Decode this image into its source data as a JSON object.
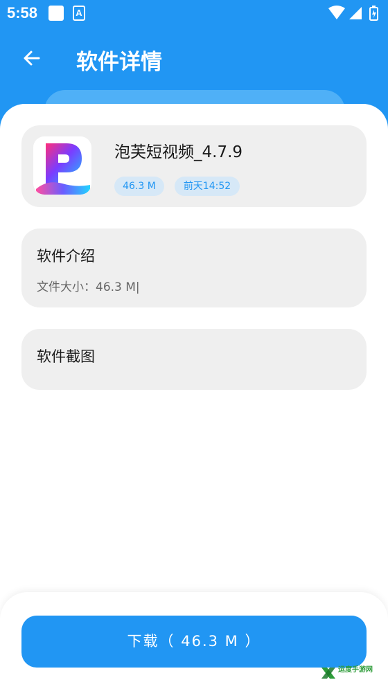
{
  "status_bar": {
    "time": "5:58",
    "notification_icons": [
      "square-icon",
      "font-a-icon"
    ],
    "right_icons": [
      "wifi-icon",
      "signal-icon",
      "battery-icon"
    ]
  },
  "app_bar": {
    "title": "软件详情",
    "back_icon": "arrow-left-icon"
  },
  "app_info": {
    "name": "泡芙短视频_4.7.9",
    "size": "46.3 M",
    "date": "前天14:52",
    "icon": "app-logo-p"
  },
  "intro": {
    "title": "软件介绍",
    "body": "文件大小：46.3 M|"
  },
  "screenshots": {
    "title": "软件截图"
  },
  "download": {
    "label": "下载（ 46.3 M ）"
  },
  "watermark": {
    "text": "运度手游网"
  },
  "colors": {
    "primary": "#2196F3",
    "card_bg": "#EFEFEF",
    "tag_bg": "#D6E8F7"
  }
}
